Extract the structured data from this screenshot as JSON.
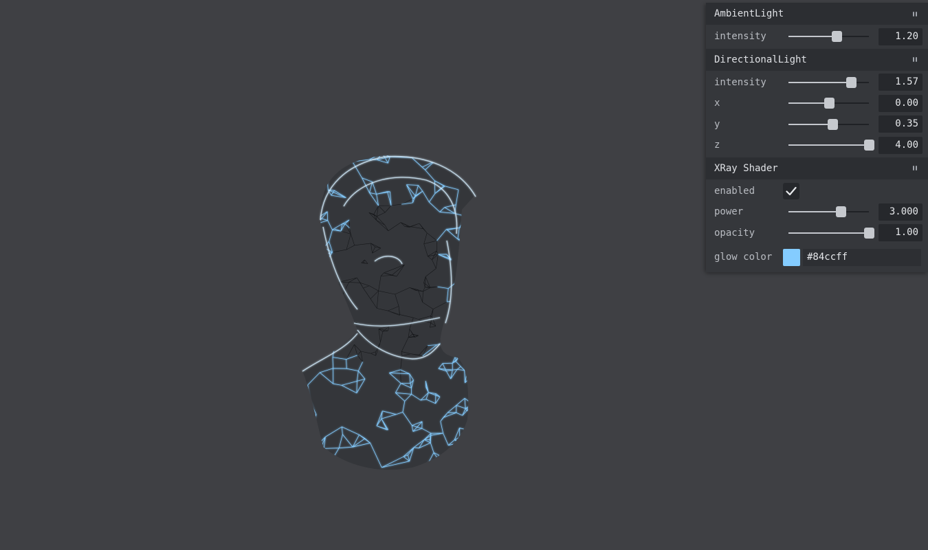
{
  "panel": {
    "ambient": {
      "title": "AmbientLight",
      "intensity": {
        "label": "intensity",
        "value": "1.20",
        "fraction": 0.6
      }
    },
    "directional": {
      "title": "DirectionalLight",
      "intensity": {
        "label": "intensity",
        "value": "1.57",
        "fraction": 0.78
      },
      "x": {
        "label": "x",
        "value": "0.00",
        "fraction": 0.5
      },
      "y": {
        "label": "y",
        "value": "0.35",
        "fraction": 0.545
      },
      "z": {
        "label": "z",
        "value": "4.00",
        "fraction": 1.0
      }
    },
    "xray": {
      "title": "XRay Shader",
      "enabled": {
        "label": "enabled",
        "checked": true
      },
      "power": {
        "label": "power",
        "value": "3.000",
        "fraction": 0.65
      },
      "opacity": {
        "label": "opacity",
        "value": "1.00",
        "fraction": 1.0
      },
      "glow": {
        "label": "glow color",
        "value": "#84ccff"
      }
    }
  },
  "colors": {
    "background": "#3f4044",
    "glow": "#84ccff",
    "wire_dark": "#0d0e10"
  },
  "icons": {
    "checkmark": "check-icon",
    "folder_toggle": "collapse-icon"
  }
}
